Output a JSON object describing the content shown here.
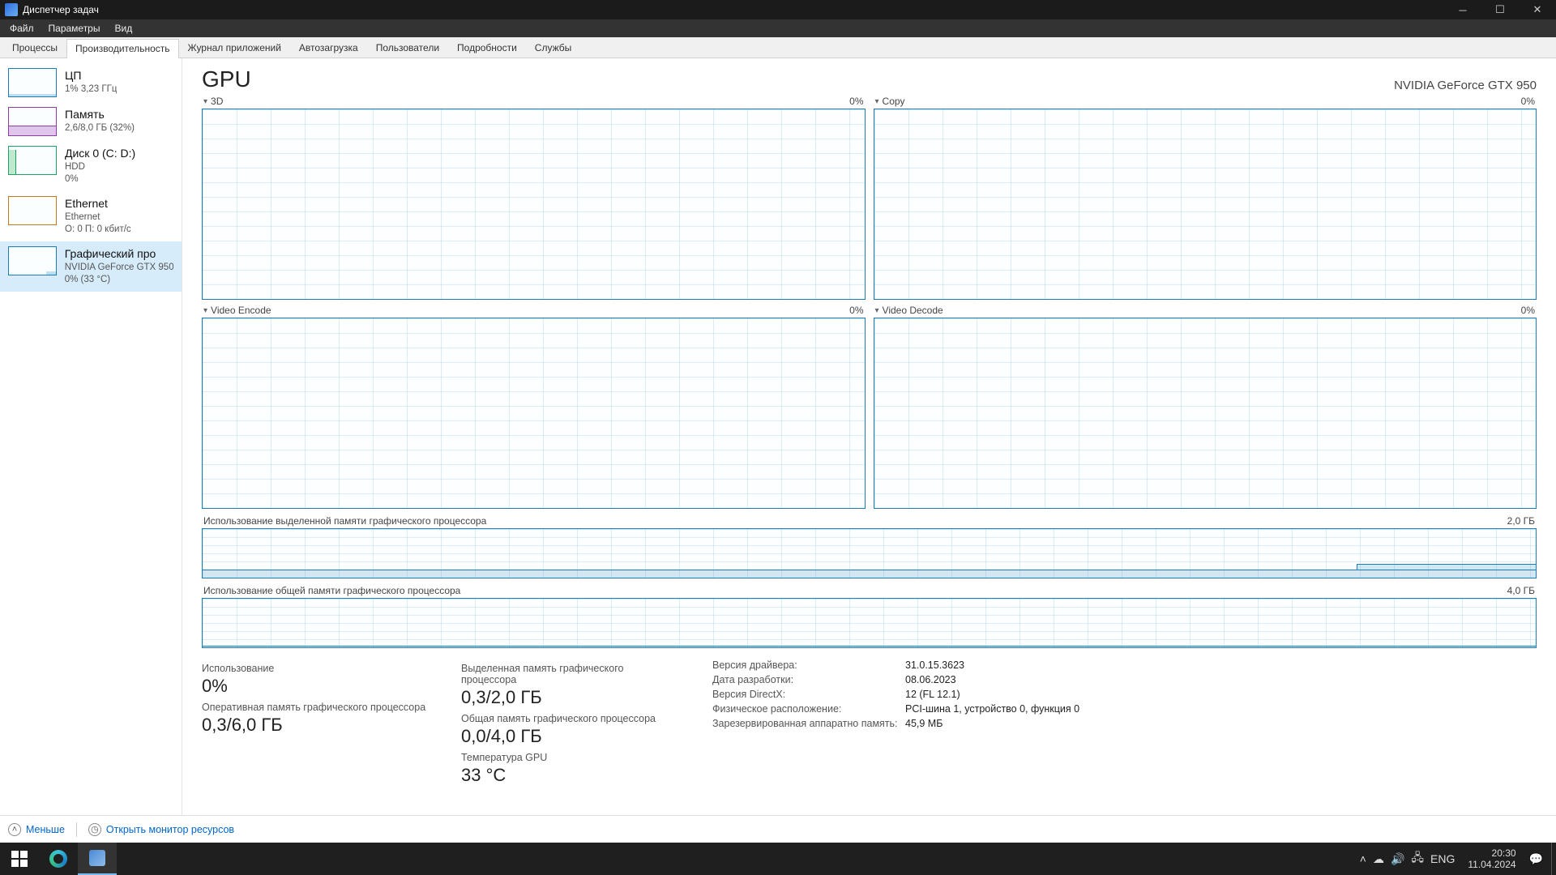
{
  "window": {
    "title": "Диспетчер задач"
  },
  "menu": {
    "file": "Файл",
    "options": "Параметры",
    "view": "Вид"
  },
  "tabs": {
    "processes": "Процессы",
    "performance": "Производительность",
    "app_history": "Журнал приложений",
    "startup": "Автозагрузка",
    "users": "Пользователи",
    "details": "Подробности",
    "services": "Службы"
  },
  "sidebar": {
    "cpu": {
      "name": "ЦП",
      "sub": "1%  3,23 ГГц"
    },
    "memory": {
      "name": "Память",
      "sub": "2,6/8,0 ГБ (32%)"
    },
    "disk": {
      "name": "Диск 0 (C: D:)",
      "sub1": "HDD",
      "sub2": "0%"
    },
    "ethernet": {
      "name": "Ethernet",
      "sub1": "Ethernet",
      "sub2": "О: 0  П: 0 кбит/с"
    },
    "gpu": {
      "name": "Графический про",
      "sub1": "NVIDIA GeForce GTX 950",
      "sub2": "0%  (33 °C)"
    }
  },
  "detail": {
    "title": "GPU",
    "model": "NVIDIA GeForce GTX 950",
    "chart1": {
      "label": "3D",
      "value": "0%"
    },
    "chart2": {
      "label": "Copy",
      "value": "0%"
    },
    "chart3": {
      "label": "Video Encode",
      "value": "0%"
    },
    "chart4": {
      "label": "Video Decode",
      "value": "0%"
    },
    "dedicated_mem": {
      "label": "Использование выделенной памяти графического процессора",
      "max": "2,0 ГБ"
    },
    "shared_mem": {
      "label": "Использование общей памяти графического процессора",
      "max": "4,0 ГБ"
    }
  },
  "stats": {
    "usage_label": "Использование",
    "usage_value": "0%",
    "gpu_mem_label": "Оперативная память графического процессора",
    "gpu_mem_value": "0,3/6,0 ГБ",
    "dedicated_label": "Выделенная память графического процессора",
    "dedicated_value": "0,3/2,0 ГБ",
    "shared_label": "Общая память графического процессора",
    "shared_value": "0,0/4,0 ГБ",
    "temp_label": "Температура GPU",
    "temp_value": "33 °C",
    "driver_version_k": "Версия драйвера:",
    "driver_version_v": "31.0.15.3623",
    "driver_date_k": "Дата разработки:",
    "driver_date_v": "08.06.2023",
    "directx_k": "Версия DirectX:",
    "directx_v": "12 (FL 12.1)",
    "location_k": "Физическое расположение:",
    "location_v": "PCI-шина 1, устройство 0, функция 0",
    "reserved_k": "Зарезервированная аппаратно память:",
    "reserved_v": "45,9 МБ"
  },
  "footer": {
    "less": "Меньше",
    "open_resmon": "Открыть монитор ресурсов"
  },
  "taskbar": {
    "lang": "ENG",
    "time": "20:30",
    "date": "11.04.2024"
  },
  "chart_data": [
    {
      "type": "line",
      "title": "3D",
      "ylim": [
        0,
        100
      ],
      "series": [
        {
          "name": "3D",
          "values": [
            0,
            0,
            0,
            0,
            0,
            0,
            0,
            0,
            0,
            0,
            0,
            0,
            0,
            0,
            0,
            0,
            0,
            0,
            0,
            0,
            0,
            0,
            0,
            0,
            0,
            0,
            0,
            0,
            2,
            0
          ]
        }
      ]
    },
    {
      "type": "line",
      "title": "Copy",
      "ylim": [
        0,
        100
      ],
      "series": [
        {
          "name": "Copy",
          "values": [
            0,
            0,
            0,
            0,
            0,
            0,
            0,
            0,
            0,
            0,
            0,
            0,
            0,
            0,
            0,
            0,
            0,
            0,
            0,
            0,
            0,
            0,
            0,
            0,
            0,
            0,
            0,
            0,
            1,
            0
          ]
        }
      ]
    },
    {
      "type": "line",
      "title": "Video Encode",
      "ylim": [
        0,
        100
      ],
      "series": [
        {
          "name": "Video Encode",
          "values": [
            0,
            0,
            0,
            0,
            0,
            0,
            0,
            0,
            0,
            0,
            0,
            0,
            0,
            0,
            0,
            0,
            0,
            0,
            0,
            0,
            0,
            0,
            0,
            0,
            0,
            0,
            0,
            0,
            0,
            0
          ]
        }
      ]
    },
    {
      "type": "line",
      "title": "Video Decode",
      "ylim": [
        0,
        100
      ],
      "series": [
        {
          "name": "Video Decode",
          "values": [
            0,
            0,
            0,
            0,
            0,
            0,
            0,
            0,
            0,
            0,
            0,
            0,
            0,
            0,
            0,
            0,
            0,
            0,
            0,
            0,
            0,
            0,
            0,
            0,
            0,
            0,
            0,
            0,
            0,
            0
          ]
        }
      ]
    },
    {
      "type": "area",
      "title": "Использование выделенной памяти графического процессора",
      "ylim": [
        0,
        2.0
      ],
      "ylabel": "ГБ",
      "series": [
        {
          "name": "Выделенная",
          "values": [
            0.3,
            0.3,
            0.3,
            0.3,
            0.3,
            0.3,
            0.3,
            0.3,
            0.3,
            0.3,
            0.3,
            0.3,
            0.3,
            0.3,
            0.3,
            0.3,
            0.3,
            0.3,
            0.3,
            0.3,
            0.3,
            0.3,
            0.3,
            0.3,
            0.3,
            0.3,
            0.3,
            0.35,
            0.4,
            0.3
          ]
        }
      ]
    },
    {
      "type": "area",
      "title": "Использование общей памяти графического процессора",
      "ylim": [
        0,
        4.0
      ],
      "ylabel": "ГБ",
      "series": [
        {
          "name": "Общая",
          "values": [
            0.0,
            0.0,
            0.0,
            0.0,
            0.0,
            0.0,
            0.0,
            0.0,
            0.0,
            0.0,
            0.0,
            0.0,
            0.0,
            0.0,
            0.0,
            0.0,
            0.0,
            0.0,
            0.0,
            0.0,
            0.0,
            0.0,
            0.0,
            0.0,
            0.0,
            0.0,
            0.0,
            0.0,
            0.0,
            0.0
          ]
        }
      ]
    }
  ]
}
